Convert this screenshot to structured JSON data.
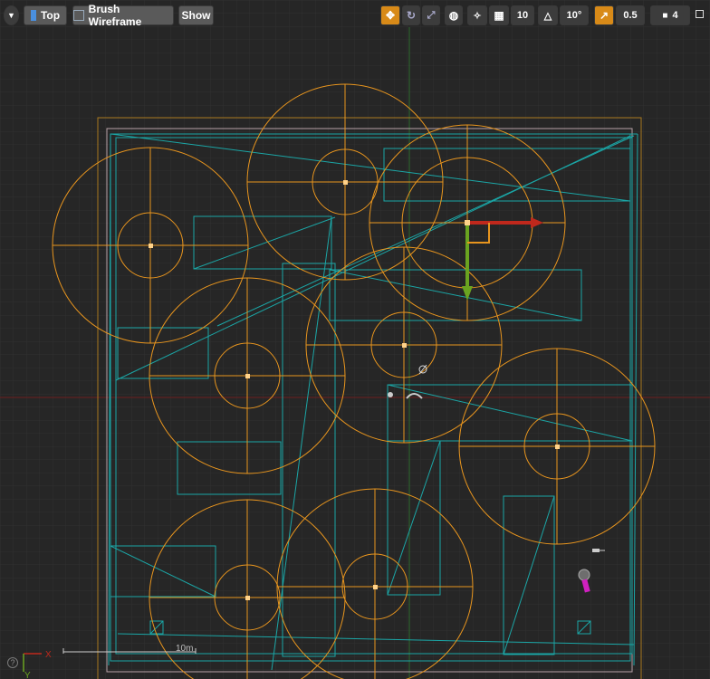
{
  "toolbar": {
    "view_mode": "Top",
    "render_mode": "Brush Wireframe",
    "show_label": "Show",
    "grid_snap_value": "10",
    "rotation_snap_value": "10°",
    "scale_snap_value": "0.5",
    "camera_speed_value": "4"
  },
  "viewport": {
    "scale_label": "10m",
    "axis_x_label": "X",
    "axis_y_label": "Y",
    "help_glyph": "?"
  },
  "colors": {
    "background": "#262626",
    "grid_minor": "#323232",
    "grid_major": "#3c3c3c",
    "brush_wireframe": "#1ba6a6",
    "selection_orange": "#e8951e",
    "gizmo_x": "#c0281c",
    "gizmo_y": "#6aa420",
    "axis_x_line": "#7a2020",
    "axis_y_line": "#2f6a2f",
    "toolbar_active": "#d88a18"
  },
  "icons": [
    "dropdown-arrow-icon",
    "top-view-icon",
    "wireframe-mode-icon",
    "translate-icon",
    "rotate-icon",
    "scale-icon",
    "world-space-icon",
    "surface-snap-icon",
    "grid-snap-icon",
    "rotation-snap-icon",
    "scale-snap-icon",
    "camera-speed-icon",
    "maximize-viewport-icon",
    "help-icon",
    "light-actor-icon",
    "camera-actor-icon"
  ]
}
